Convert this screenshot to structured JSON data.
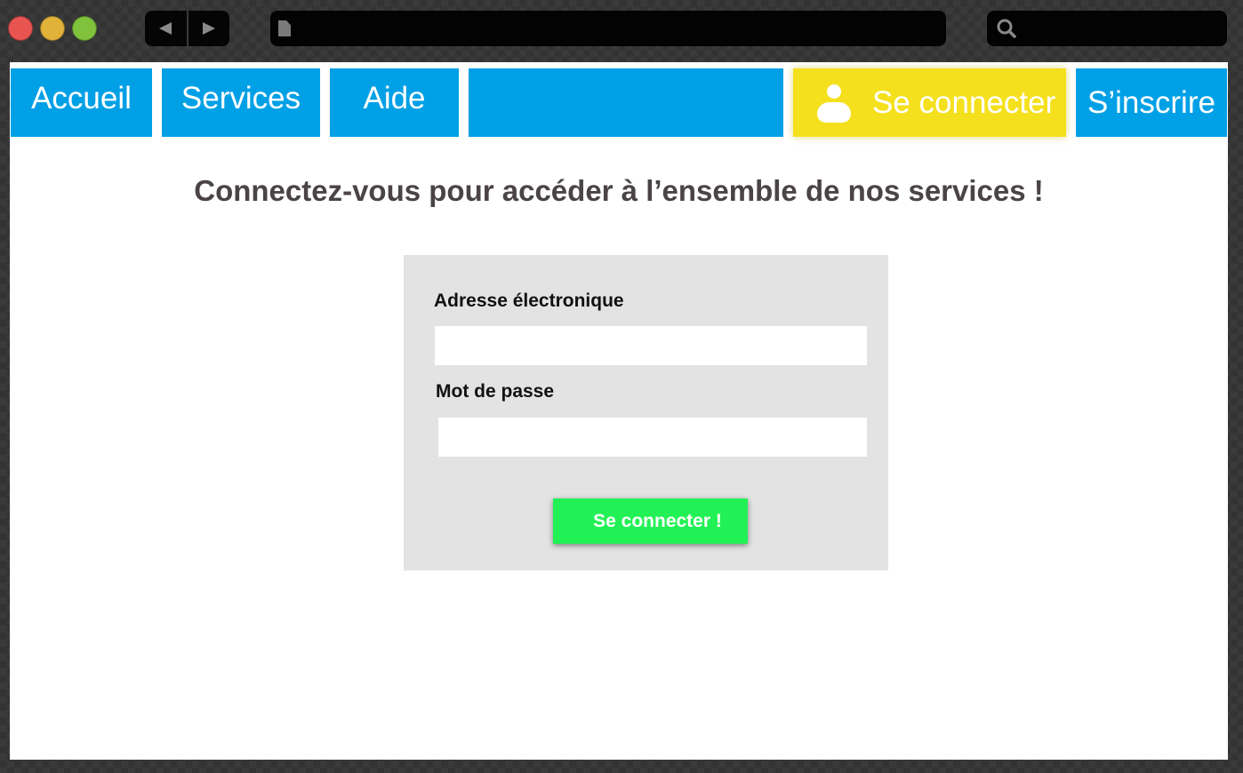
{
  "window": {
    "traffic_lights": [
      "close",
      "minimize",
      "maximize"
    ],
    "icons": {
      "back": "back-arrow-icon",
      "forward": "forward-arrow-icon",
      "address": "document-icon",
      "search": "search-icon",
      "user": "user-icon"
    }
  },
  "nav": {
    "home": "Accueil",
    "services": "Services",
    "help": "Aide",
    "login": "Se connecter",
    "signup": "S’inscrire"
  },
  "page": {
    "title": "Connectez-vous pour accéder à l’ensemble de nos services !"
  },
  "form": {
    "email_label": "Adresse électronique",
    "email_value": "",
    "password_label": "Mot de passe",
    "password_value": "",
    "submit_label": "Se connecter !"
  },
  "colors": {
    "nav_blue": "#00a0e6",
    "login_yellow": "#f5e01d",
    "submit_green": "#22f155",
    "card_gray": "#e3e3e3",
    "title_text": "#4a4444"
  }
}
